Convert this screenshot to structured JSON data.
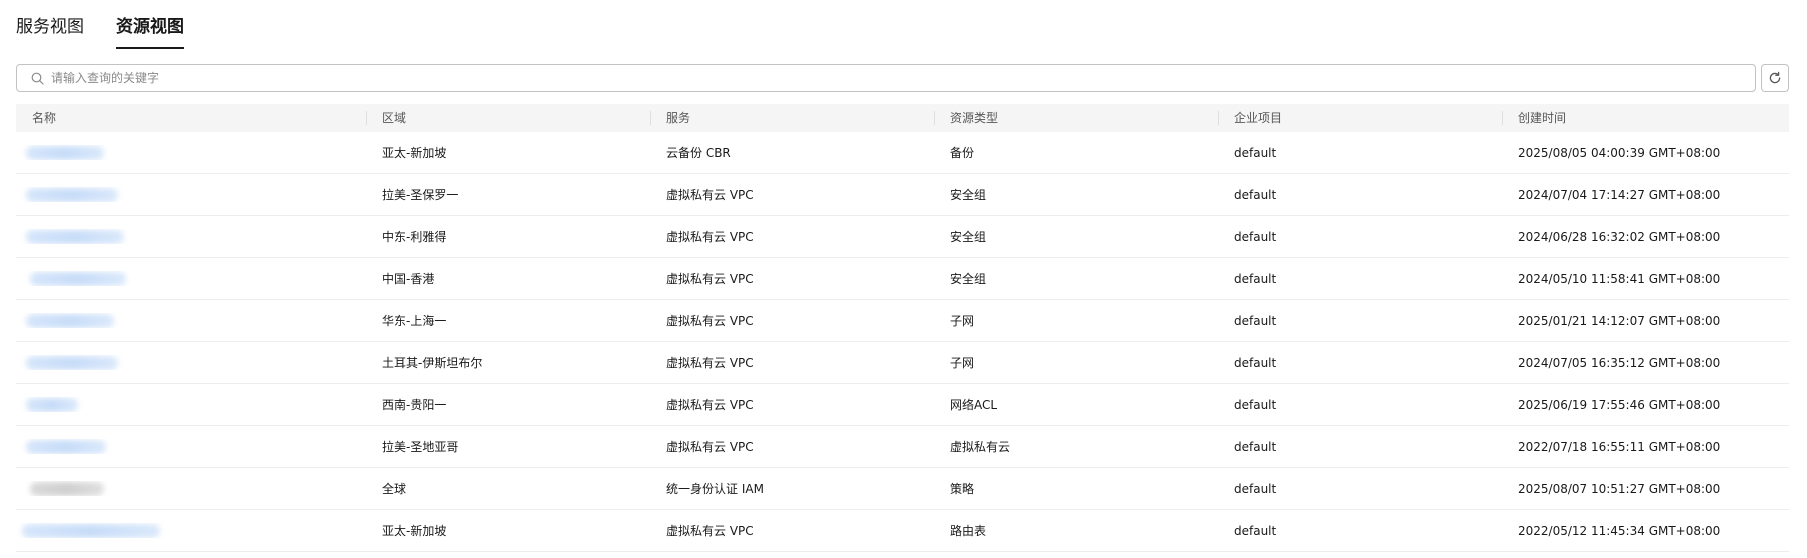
{
  "tabs": [
    {
      "label": "服务视图",
      "active": false
    },
    {
      "label": "资源视图",
      "active": true
    }
  ],
  "search": {
    "placeholder": "请输入查询的关键字",
    "value": ""
  },
  "table": {
    "columns": [
      "名称",
      "区域",
      "服务",
      "资源类型",
      "企业项目",
      "创建时间"
    ],
    "rows": [
      {
        "region": "亚太-新加坡",
        "service": "云备份 CBR",
        "type": "备份",
        "project": "default",
        "created": "2025/08/05 04:00:39 GMT+08:00"
      },
      {
        "region": "拉美-圣保罗一",
        "service": "虚拟私有云 VPC",
        "type": "安全组",
        "project": "default",
        "created": "2024/07/04 17:14:27 GMT+08:00"
      },
      {
        "region": "中东-利雅得",
        "service": "虚拟私有云 VPC",
        "type": "安全组",
        "project": "default",
        "created": "2024/06/28 16:32:02 GMT+08:00"
      },
      {
        "region": "中国-香港",
        "service": "虚拟私有云 VPC",
        "type": "安全组",
        "project": "default",
        "created": "2024/05/10 11:58:41 GMT+08:00"
      },
      {
        "region": "华东-上海一",
        "service": "虚拟私有云 VPC",
        "type": "子网",
        "project": "default",
        "created": "2025/01/21 14:12:07 GMT+08:00"
      },
      {
        "region": "土耳其-伊斯坦布尔",
        "service": "虚拟私有云 VPC",
        "type": "子网",
        "project": "default",
        "created": "2024/07/05 16:35:12 GMT+08:00"
      },
      {
        "region": "西南-贵阳一",
        "service": "虚拟私有云 VPC",
        "type": "网络ACL",
        "project": "default",
        "created": "2025/06/19 17:55:46 GMT+08:00"
      },
      {
        "region": "拉美-圣地亚哥",
        "service": "虚拟私有云 VPC",
        "type": "虚拟私有云",
        "project": "default",
        "created": "2022/07/18 16:55:11 GMT+08:00"
      },
      {
        "region": "全球",
        "service": "统一身份认证 IAM",
        "type": "策略",
        "project": "default",
        "created": "2025/08/07 10:51:27 GMT+08:00"
      },
      {
        "region": "亚太-新加坡",
        "service": "虚拟私有云 VPC",
        "type": "路由表",
        "project": "default",
        "created": "2022/05/12 11:45:34 GMT+08:00"
      }
    ]
  },
  "icons": {
    "search": "search-icon",
    "refresh": "refresh-icon"
  },
  "colors": {
    "text": "#191919",
    "header_bg": "#f5f5f5",
    "border": "#c2c2c2"
  }
}
